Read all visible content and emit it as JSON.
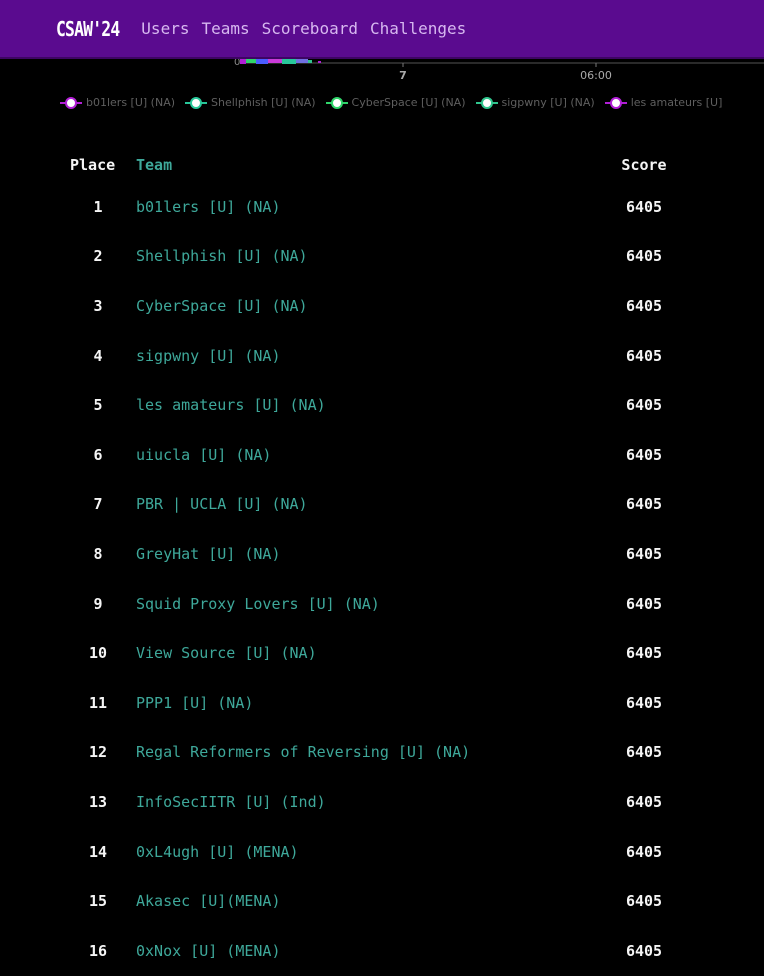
{
  "brand": "CSAW'24",
  "nav": [
    "Users",
    "Teams",
    "Scoreboard",
    "Challenges"
  ],
  "chart": {
    "y_tick": "0",
    "x_ticks": [
      "7",
      "06:00"
    ]
  },
  "legend": [
    {
      "label": "b01lers [U] (NA)",
      "color": "#b11fd6"
    },
    {
      "label": "Shellphish [U] (NA)",
      "color": "#28c79a"
    },
    {
      "label": "CyberSpace [U] (NA)",
      "color": "#2fd56a"
    },
    {
      "label": "sigpwny [U] (NA)",
      "color": "#2fc58d"
    },
    {
      "label": "les amateurs [U]",
      "color": "#b11fd6"
    }
  ],
  "table": {
    "headers": {
      "place": "Place",
      "team": "Team",
      "score": "Score"
    },
    "rows": [
      {
        "place": "1",
        "team": "b01lers [U] (NA)",
        "score": "6405"
      },
      {
        "place": "2",
        "team": "Shellphish [U] (NA)",
        "score": "6405"
      },
      {
        "place": "3",
        "team": "CyberSpace [U] (NA)",
        "score": "6405"
      },
      {
        "place": "4",
        "team": "sigpwny [U] (NA)",
        "score": "6405"
      },
      {
        "place": "5",
        "team": "les amateurs [U] (NA)",
        "score": "6405"
      },
      {
        "place": "6",
        "team": "uiucla [U] (NA)",
        "score": "6405"
      },
      {
        "place": "7",
        "team": "PBR | UCLA [U] (NA)",
        "score": "6405"
      },
      {
        "place": "8",
        "team": "GreyHat [U] (NA)",
        "score": "6405"
      },
      {
        "place": "9",
        "team": "Squid Proxy Lovers [U] (NA)",
        "score": "6405"
      },
      {
        "place": "10",
        "team": "View Source [U] (NA)",
        "score": "6405"
      },
      {
        "place": "11",
        "team": "PPP1 [U] (NA)",
        "score": "6405"
      },
      {
        "place": "12",
        "team": "Regal Reformers of Reversing [U] (NA)",
        "score": "6405"
      },
      {
        "place": "13",
        "team": "InfoSecIITR [U] (Ind)",
        "score": "6405"
      },
      {
        "place": "14",
        "team": "0xL4ugh [U] (MENA)",
        "score": "6405"
      },
      {
        "place": "15",
        "team": "Akasec [U](MENA)",
        "score": "6405"
      },
      {
        "place": "16",
        "team": "0xNox [U] (MENA)",
        "score": "6405"
      }
    ]
  }
}
